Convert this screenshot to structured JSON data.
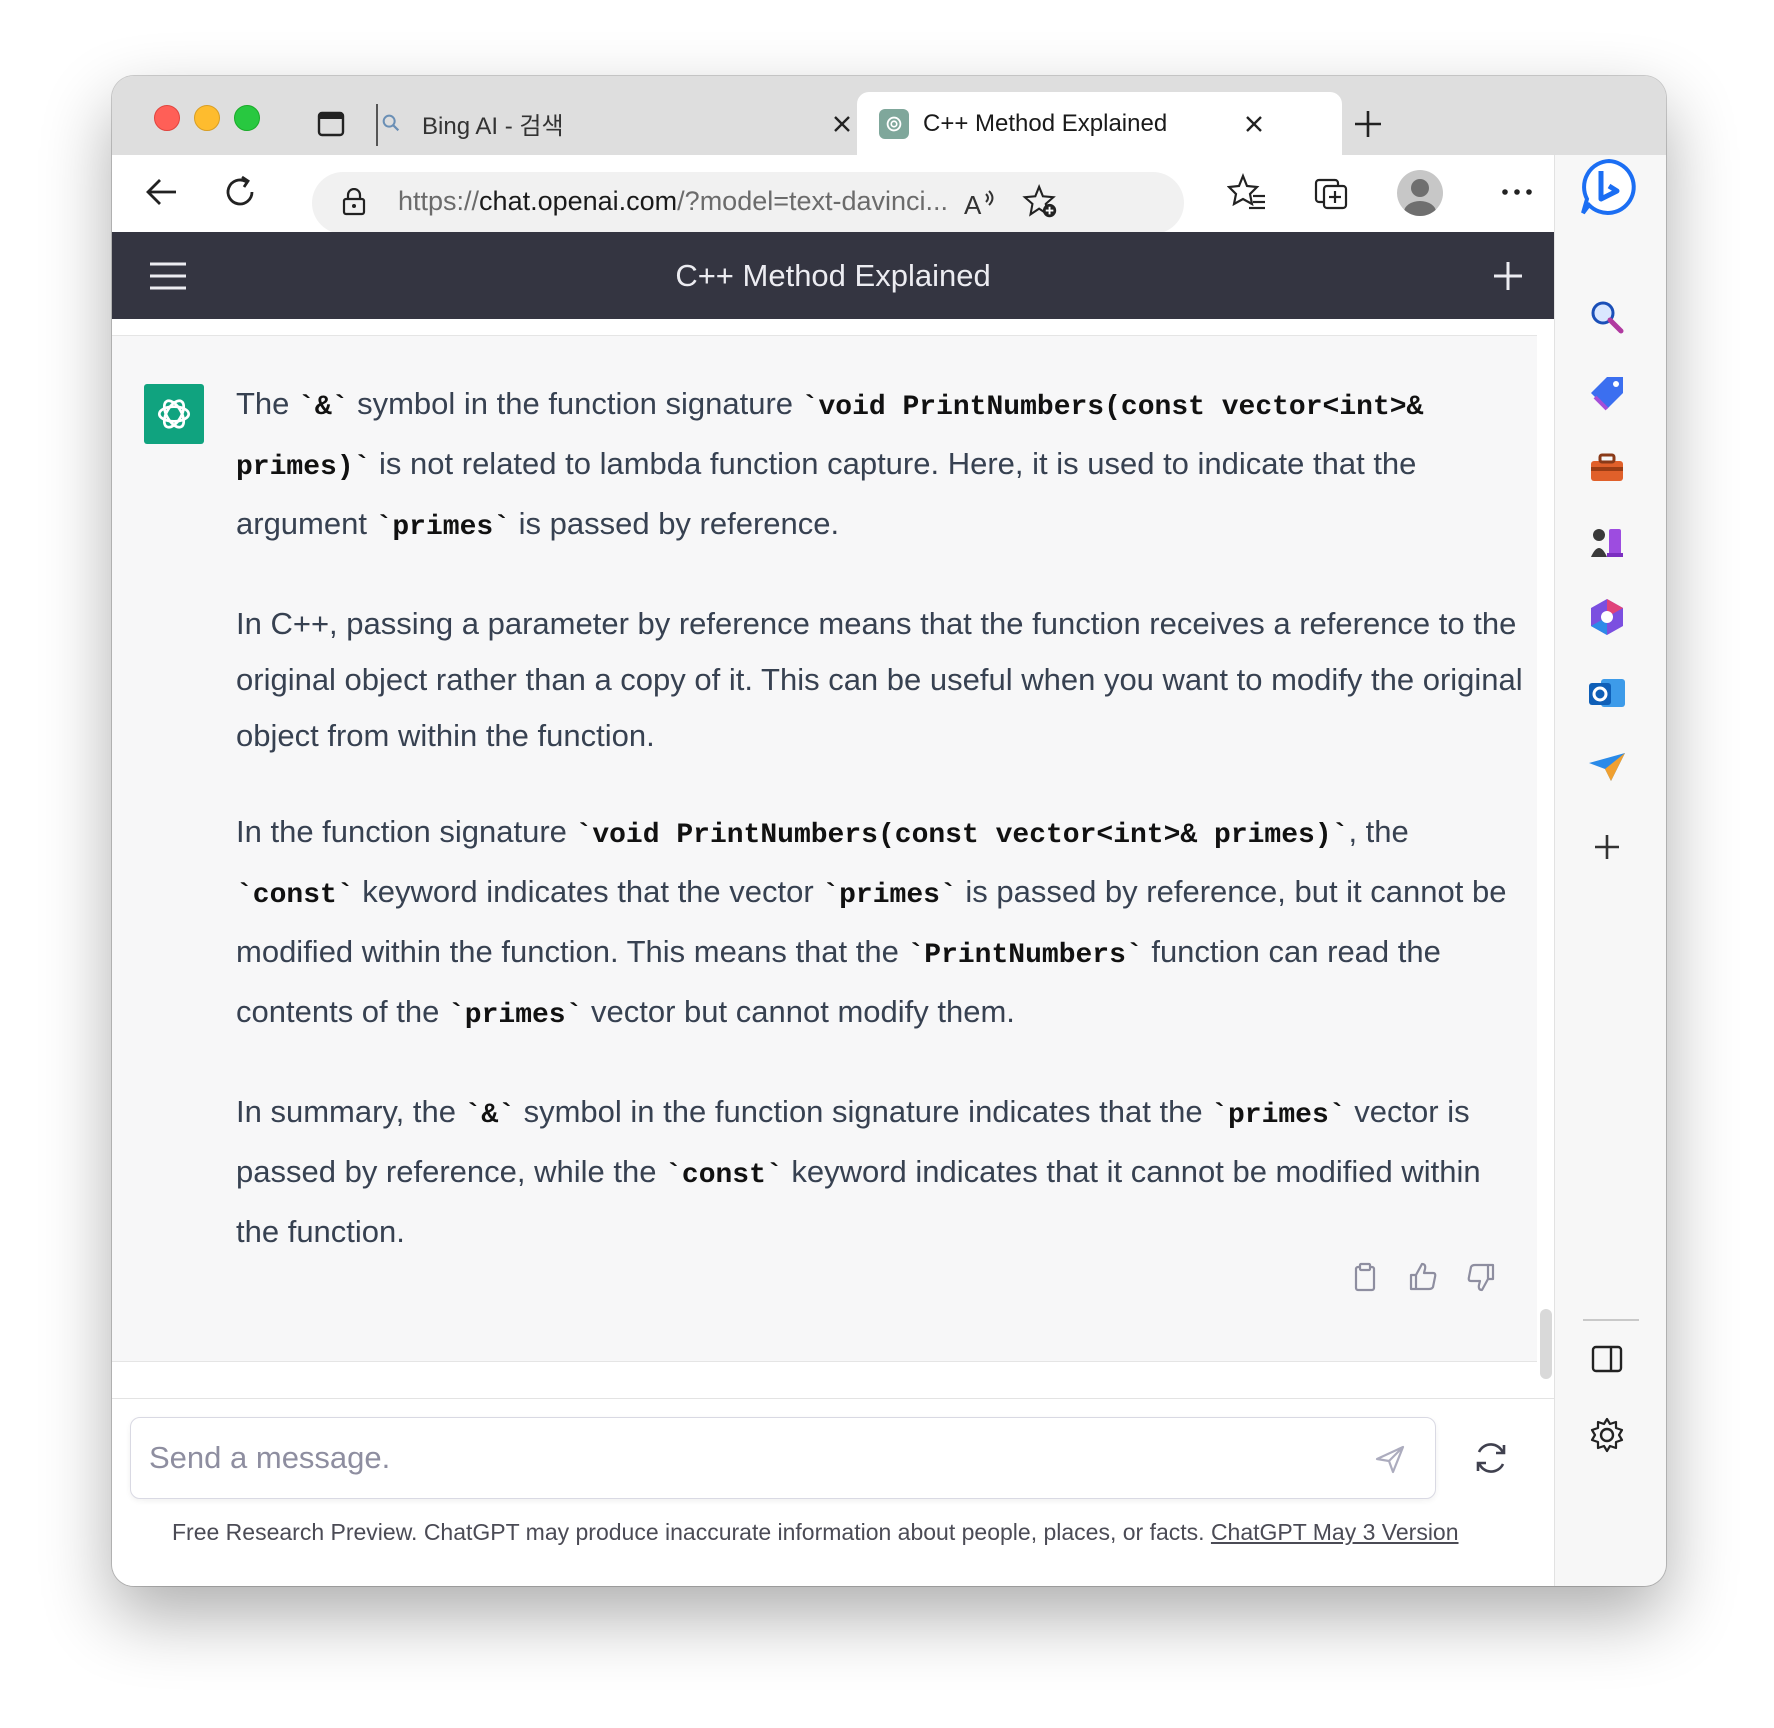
{
  "browser": {
    "tabs": [
      {
        "title": "Bing AI - 검색",
        "active": false
      },
      {
        "title": "C++ Method Explained",
        "active": true
      }
    ],
    "url_scheme": "https://",
    "url_host": "chat.openai.com",
    "url_rest": "/?model=text-davinci..."
  },
  "chat": {
    "header_title": "C++ Method Explained",
    "paragraphs": [
      [
        {
          "t": "The "
        },
        {
          "c": "`&`"
        },
        {
          "t": " symbol in the function signature "
        },
        {
          "c": "`void PrintNumbers(const vector<int>& primes)`"
        },
        {
          "t": " is not related to lambda function capture. Here, it is used to indicate that the argument "
        },
        {
          "c": "`primes`"
        },
        {
          "t": " is passed by reference."
        }
      ],
      [
        {
          "t": "In C++, passing a parameter by reference means that the function receives a reference to the original object rather than a copy of it. This can be useful when you want to modify the original object from within the function."
        }
      ],
      [
        {
          "t": "In the function signature "
        },
        {
          "c": "`void PrintNumbers(const vector<int>& primes)`"
        },
        {
          "t": ", the "
        },
        {
          "c": "`const`"
        },
        {
          "t": " keyword indicates that the vector "
        },
        {
          "c": "`primes`"
        },
        {
          "t": " is passed by reference, but it cannot be modified within the function. This means that the "
        },
        {
          "c": "`PrintNumbers`"
        },
        {
          "t": " function can read the contents of the "
        },
        {
          "c": "`primes`"
        },
        {
          "t": " vector but cannot modify them."
        }
      ],
      [
        {
          "t": "In summary, the "
        },
        {
          "c": "`&`"
        },
        {
          "t": " symbol in the function signature indicates that the "
        },
        {
          "c": "`primes`"
        },
        {
          "t": " vector is passed by reference, while the "
        },
        {
          "c": "`const`"
        },
        {
          "t": " keyword indicates that it cannot be modified within the function."
        }
      ]
    ],
    "input_placeholder": "Send a message.",
    "disclaimer_text": "Free Research Preview. ChatGPT may produce inaccurate information about people, places, or facts. ",
    "disclaimer_link": "ChatGPT May 3 Version"
  },
  "colors": {
    "header_bg": "#343541",
    "chatgpt_green": "#10a37f",
    "edge_blue": "#1b6ef3"
  },
  "icons": {
    "sidebar": [
      "search-icon",
      "tag-icon",
      "toolbox-icon",
      "chess-icon",
      "office-icon",
      "outlook-icon",
      "send-paper-plane-icon",
      "add-icon",
      "split-screen-icon",
      "settings-icon"
    ]
  }
}
